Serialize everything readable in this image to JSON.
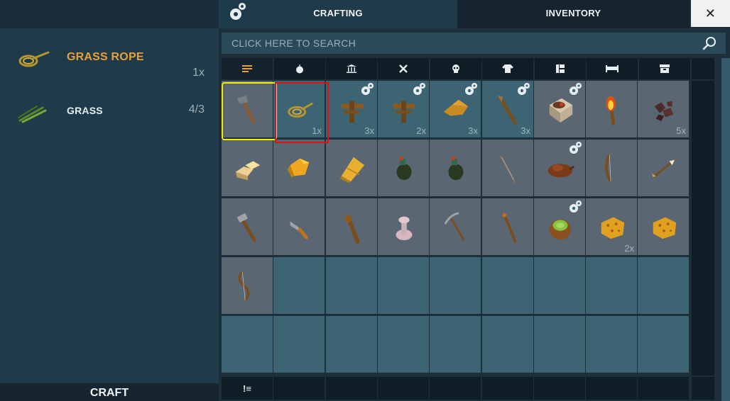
{
  "tabs": {
    "crafting": "CRAFTING",
    "inventory": "INVENTORY",
    "close": "✕"
  },
  "search": {
    "placeholder": "CLICK HERE TO SEARCH"
  },
  "recipe": {
    "output": {
      "name": "GRASS ROPE",
      "quantity": "1x",
      "icon": "grass-rope-icon"
    },
    "ingredients": [
      {
        "name": "GRASS",
        "amount": "4/3",
        "icon": "grass-icon"
      }
    ]
  },
  "craft_button": "CRAFT",
  "categories": [
    {
      "icon": "list-icon",
      "active": true
    },
    {
      "icon": "apple-icon"
    },
    {
      "icon": "building-icon"
    },
    {
      "icon": "tools-icon"
    },
    {
      "icon": "skull-icon"
    },
    {
      "icon": "shirt-icon"
    },
    {
      "icon": "book-icon"
    },
    {
      "icon": "bed-icon"
    },
    {
      "icon": "chest-icon"
    }
  ],
  "slots": [
    {
      "item": "stone-hatchet",
      "bg": "gray",
      "qty": ""
    },
    {
      "item": "grass-rope",
      "bg": "teal",
      "qty": "1x"
    },
    {
      "item": "wood-frame",
      "bg": "teal",
      "qty": "3x",
      "gear": true
    },
    {
      "item": "wood-frame",
      "bg": "teal",
      "qty": "2x",
      "gear": true
    },
    {
      "item": "wood-planks",
      "bg": "teal",
      "qty": "3x",
      "gear": true
    },
    {
      "item": "spear",
      "bg": "teal",
      "qty": "3x",
      "gear": true
    },
    {
      "item": "cooking-pot",
      "bg": "gray",
      "qty": "",
      "gear": true
    },
    {
      "item": "torch",
      "bg": "gray",
      "qty": ""
    },
    {
      "item": "ore-chunks",
      "bg": "gray",
      "qty": "5x"
    },
    {
      "item": "sandstone",
      "bg": "gray",
      "qty": ""
    },
    {
      "item": "gold-ore",
      "bg": "gray",
      "qty": ""
    },
    {
      "item": "hay-bundle",
      "bg": "gray",
      "qty": ""
    },
    {
      "item": "water-flask",
      "bg": "gray",
      "qty": ""
    },
    {
      "item": "water-flask",
      "bg": "gray",
      "qty": ""
    },
    {
      "item": "fishing-rod",
      "bg": "gray",
      "qty": ""
    },
    {
      "item": "leather-bag",
      "bg": "gray",
      "qty": "",
      "gear": true
    },
    {
      "item": "bow",
      "bg": "gray",
      "qty": ""
    },
    {
      "item": "arrow",
      "bg": "gray",
      "qty": ""
    },
    {
      "item": "stone-hammer",
      "bg": "gray",
      "qty": ""
    },
    {
      "item": "knife",
      "bg": "gray",
      "qty": ""
    },
    {
      "item": "club",
      "bg": "gray",
      "qty": ""
    },
    {
      "item": "mushroom",
      "bg": "gray",
      "qty": ""
    },
    {
      "item": "pickaxe",
      "bg": "gray",
      "qty": ""
    },
    {
      "item": "wooden-stick",
      "bg": "gray",
      "qty": ""
    },
    {
      "item": "coconut",
      "bg": "gray",
      "qty": "",
      "gear": true
    },
    {
      "item": "sponge",
      "bg": "gray",
      "qty": "2x"
    },
    {
      "item": "sponge",
      "bg": "gray",
      "qty": ""
    },
    {
      "item": "recurve-bow",
      "bg": "gray",
      "qty": ""
    }
  ],
  "bottom_bar": {
    "sort_icon": "sort-icon",
    "sort_label": "!≡"
  },
  "colors": {
    "accent": "#e8a03a",
    "slot_gray": "#5a6672",
    "slot_teal": "#3d6472",
    "highlight_yellow": "#f5f000",
    "highlight_red": "#e01010"
  }
}
